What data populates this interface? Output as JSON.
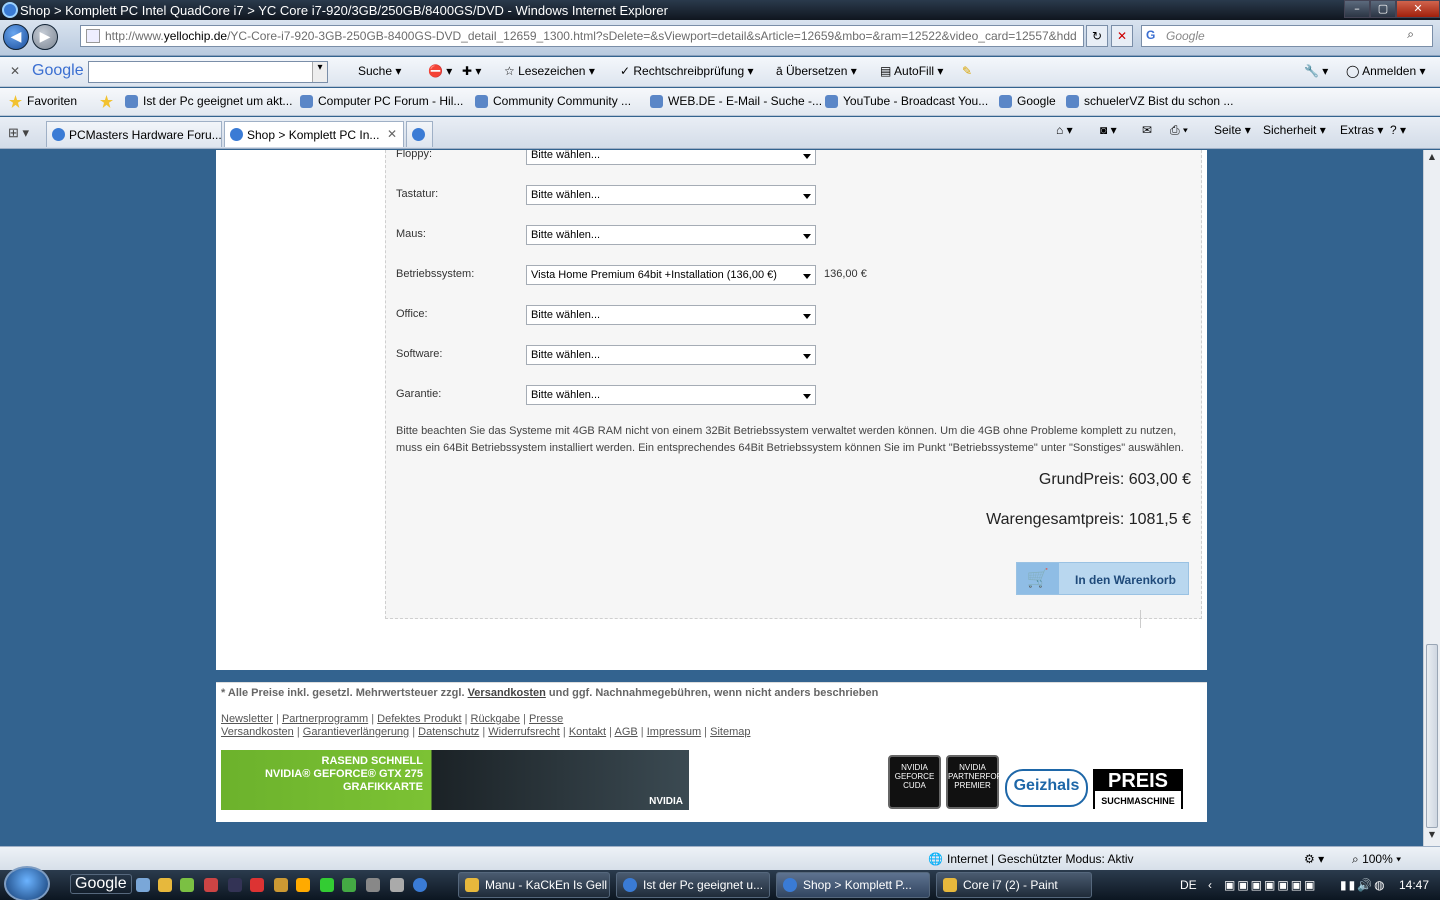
{
  "window": {
    "title": "Shop > Komplett PC Intel QuadCore i7 > YC Core i7-920/3GB/250GB/8400GS/DVD - Windows Internet Explorer",
    "min": "–",
    "max": "▢",
    "close": "✕"
  },
  "navbar": {
    "back": "◀",
    "forward": "▶",
    "url_prefix": "http://www.",
    "url_domain": "yellochip.de",
    "url_rest": "/YC-Core-i7-920-3GB-250GB-8400GS-DVD_detail_12659_1300.html?sDelete=&sViewport=detail&sArticle=12659&mbo=&ram=12522&video_card=12557&hdd",
    "refresh": "↻",
    "stop": "✕",
    "search_placeholder": "Google"
  },
  "google_toolbar": {
    "close": "✕",
    "logo": "Google",
    "search_label": "Suche",
    "bookmarks_label": "Lesezeichen",
    "spellcheck_label": "Rechtschreibprüfung",
    "translate_label": "Übersetzen",
    "autofill_label": "AutoFill",
    "signin_label": "Anmelden"
  },
  "favorites": {
    "favorites_label": "Favoriten",
    "items": [
      "Ist der Pc geeignet um akt...",
      "Computer PC Forum - Hil...",
      "Community  Community ...",
      "WEB.DE - E-Mail - Suche -...",
      "YouTube - Broadcast You...",
      "Google",
      "schuelerVZ  Bist du schon ..."
    ]
  },
  "tabs": [
    {
      "label": "PCMasters Hardware Foru..."
    },
    {
      "label": "Shop > Komplett PC In...",
      "close": "✕"
    }
  ],
  "commandbar": {
    "page": "Seite",
    "safety": "Sicherheit",
    "extras": "Extras",
    "help": "?"
  },
  "config": {
    "rows": [
      {
        "label": "Floppy:",
        "value": "Bitte wählen...",
        "price": ""
      },
      {
        "label": "Tastatur:",
        "value": "Bitte wählen...",
        "price": ""
      },
      {
        "label": "Maus:",
        "value": "Bitte wählen...",
        "price": ""
      },
      {
        "label": "Betriebssystem:",
        "value": "Vista Home Premium 64bit +Installation (136,00 €)",
        "price": "136,00 €"
      },
      {
        "label": "Office:",
        "value": "Bitte wählen...",
        "price": ""
      },
      {
        "label": "Software:",
        "value": "Bitte wählen...",
        "price": ""
      },
      {
        "label": "Garantie:",
        "value": "Bitte wählen...",
        "price": ""
      }
    ],
    "note": "Bitte beachten Sie das Systeme mit 4GB RAM nicht von einem 32Bit Betriebssystem verwaltet werden können. Um die 4GB ohne Probleme komplett zu nutzen, muss ein 64Bit Betriebssystem installiert werden. Ein entsprechendes 64Bit Betriebssystem können Sie im Punkt \"Betriebssysteme\" unter \"Sonstiges\" auswählen.",
    "base_price": "GrundPreis: 603,00 €",
    "total_price": "Warengesamtpreis: 1081,5 €",
    "cart_button": "In den Warenkorb"
  },
  "footer": {
    "vat_text": "* Alle Preise inkl. gesetzl. Mehrwertsteuer zzgl.",
    "vat_link": "Versandkosten",
    "vat_rest": "und ggf. Nachnahmegebühren, wenn nicht anders beschrieben",
    "links_row1": [
      "Newsletter",
      "Partnerprogramm",
      "Defektes Produkt",
      "Rückgabe",
      "Presse"
    ],
    "links_row2": [
      "Versandkosten",
      "Garantieverlängerung",
      "Datenschutz",
      "Widerrufsrecht",
      "Kontakt",
      "AGB",
      "Impressum",
      "Sitemap"
    ],
    "banner_line1": "RASEND SCHNELL",
    "banner_line2": "NVIDIA® GEFORCE® GTX 275",
    "banner_line3": "GRAFIKKARTE",
    "banner_brand": "NVIDIA",
    "logo1": "NVIDIA GEFORCE CUDA",
    "logo2": "NVIDIA PARTNERFORCE PREMIER",
    "logo3": "Geizhals",
    "logo4_main": "PREIS",
    "logo4_sub": "SUCHMASCHINE"
  },
  "statusbar": {
    "zone": "Internet | Geschützter Modus: Aktiv",
    "zoom": "100%"
  },
  "taskbar": {
    "google": "Google",
    "buttons": [
      {
        "label": "Manu - KaCkEn Is Gell",
        "type": "folder"
      },
      {
        "label": "Ist der Pc geeignet u...",
        "type": "ie"
      },
      {
        "label": "Shop > Komplett P...",
        "type": "ie"
      },
      {
        "label": "Core i7 (2) - Paint",
        "type": "paint"
      }
    ],
    "lang": "DE",
    "clock": "14:47"
  }
}
